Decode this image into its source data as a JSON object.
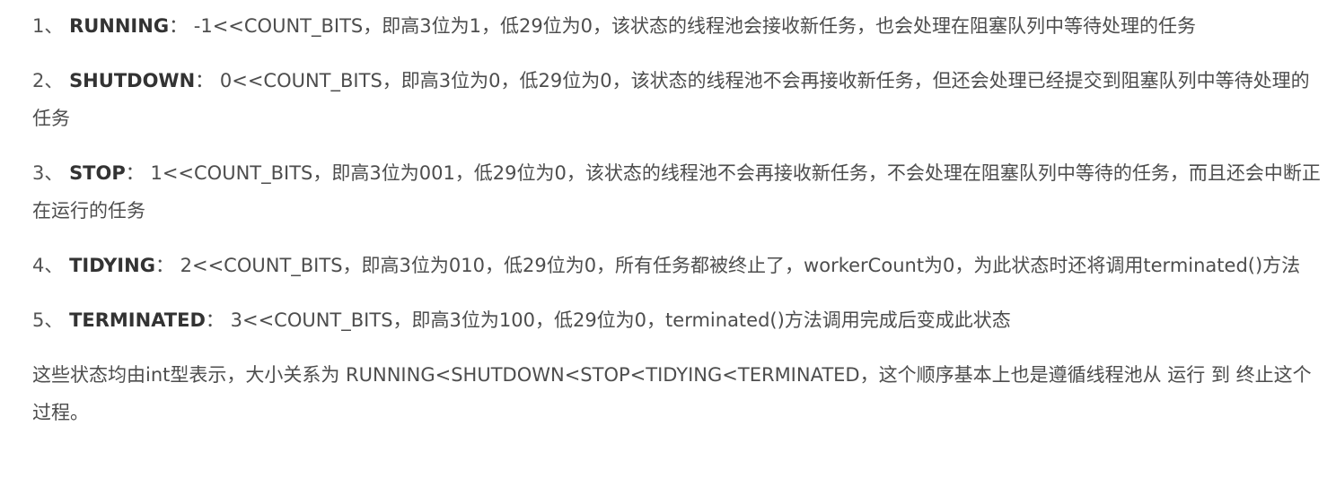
{
  "states": [
    {
      "number": "1、",
      "name": "RUNNING",
      "separator": "：",
      "description": "-1<<COUNT_BITS，即高3位为1，低29位为0，该状态的线程池会接收新任务，也会处理在阻塞队列中等待处理的任务"
    },
    {
      "number": "2、",
      "name": "SHUTDOWN",
      "separator": "：",
      "description": "0<<COUNT_BITS，即高3位为0，低29位为0，该状态的线程池不会再接收新任务，但还会处理已经提交到阻塞队列中等待处理的任务"
    },
    {
      "number": "3、",
      "name": "STOP",
      "separator": "：",
      "description": "1<<COUNT_BITS，即高3位为001，低29位为0，该状态的线程池不会再接收新任务，不会处理在阻塞队列中等待的任务，而且还会中断正在运行的任务"
    },
    {
      "number": "4、",
      "name": "TIDYING",
      "separator": "：",
      "description": "2<<COUNT_BITS，即高3位为010，低29位为0，所有任务都被终止了，workerCount为0，为此状态时还将调用terminated()方法"
    },
    {
      "number": "5、",
      "name": "TERMINATED",
      "separator": "：",
      "description": "3<<COUNT_BITS，即高3位为100，低29位为0，terminated()方法调用完成后变成此状态"
    }
  ],
  "summary": "这些状态均由int型表示，大小关系为 RUNNING<SHUTDOWN<STOP<TIDYING<TERMINATED，这个顺序基本上也是遵循线程池从 运行 到 终止这个过程。"
}
